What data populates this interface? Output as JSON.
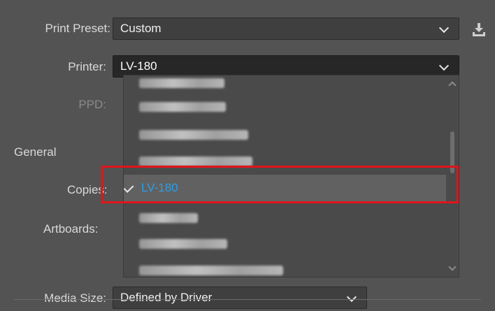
{
  "form": {
    "print_preset_label": "Print Preset:",
    "print_preset_value": "Custom",
    "printer_label": "Printer:",
    "printer_value": "LV-180",
    "ppd_label": "PPD:",
    "general_label": "General",
    "copies_label": "Copies:",
    "artboards_label": "Artboards:",
    "media_size_label": "Media Size:",
    "media_size_value": "Defined by Driver"
  },
  "printer_dropdown": {
    "selected": "LV-180",
    "items": [
      "[redacted]",
      "[redacted]",
      "[redacted]",
      "[redacted]",
      "LV-180",
      "[redacted]",
      "[redacted]",
      "[redacted]"
    ]
  },
  "icons": {
    "download": "download-icon",
    "check": "check-icon",
    "chevron": "chevron-down-icon"
  },
  "colors": {
    "selected_text": "#2f9ee6",
    "highlight_border": "#e0141b",
    "panel_bg": "#535353"
  }
}
